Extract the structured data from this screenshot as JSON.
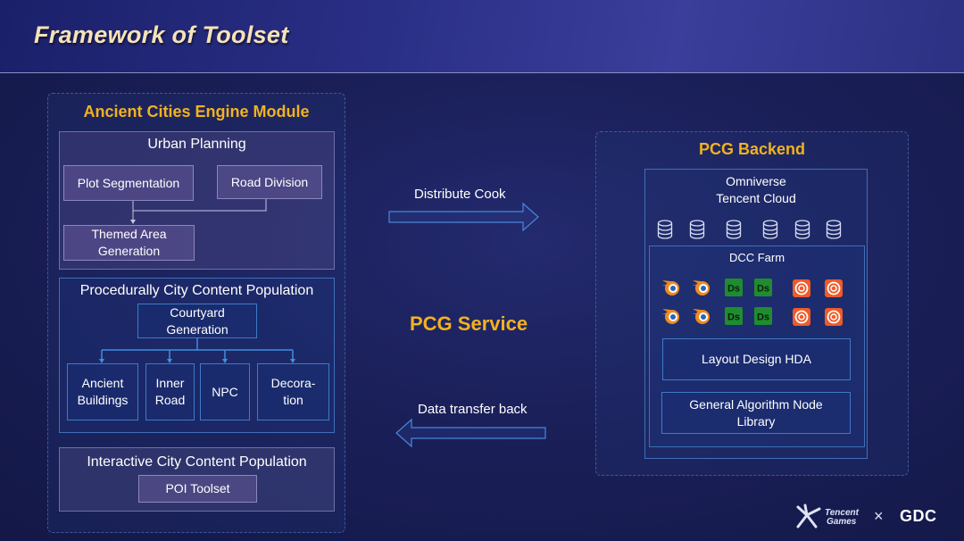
{
  "header": {
    "title": "Framework of Toolset"
  },
  "left_module": {
    "title": "Ancient Cities Engine Module",
    "urban_planning": {
      "title": "Urban Planning",
      "plot_segmentation": "Plot Segmentation",
      "road_division": "Road Division",
      "themed_area": "Themed Area Generation"
    },
    "population": {
      "title": "Procedurally City Content Population",
      "courtyard": "Courtyard Generation",
      "ancient_buildings": "Ancient Buildings",
      "inner_road": "Inner Road",
      "npc": "NPC",
      "decoration": "Decora-tion"
    },
    "interactive": {
      "title": "Interactive City Content Population",
      "poi_toolset": "POI Toolset"
    }
  },
  "middle": {
    "distribute_cook": "Distribute Cook",
    "pcg_service": "PCG Service",
    "data_transfer_back": "Data transfer back"
  },
  "right_module": {
    "title": "PCG Backend",
    "cloud_line1": "Omniverse",
    "cloud_line2": "Tencent Cloud",
    "dcc_farm": "DCC Farm",
    "ds_label": "Ds",
    "layout_design": "Layout Design HDA",
    "general_algorithm": "General Algorithm Node Library"
  },
  "footer": {
    "tencent_line1": "Tencent",
    "tencent_line2": "Games",
    "times": "×",
    "gdc": "GDC"
  },
  "colors": {
    "accent_gold": "#f2b21f",
    "title_cream": "#f6e2b8",
    "connector_blue": "#3d8fe0",
    "blender_orange": "#f08a1e",
    "houdini_orange": "#f05a28",
    "ds_green": "#1f8c2f"
  },
  "icons": [
    "database-icon",
    "blender-icon",
    "daz-studio-icon",
    "houdini-icon",
    "arrow-right-icon",
    "arrow-left-icon",
    "tencent-games-logo",
    "gdc-logo"
  ]
}
